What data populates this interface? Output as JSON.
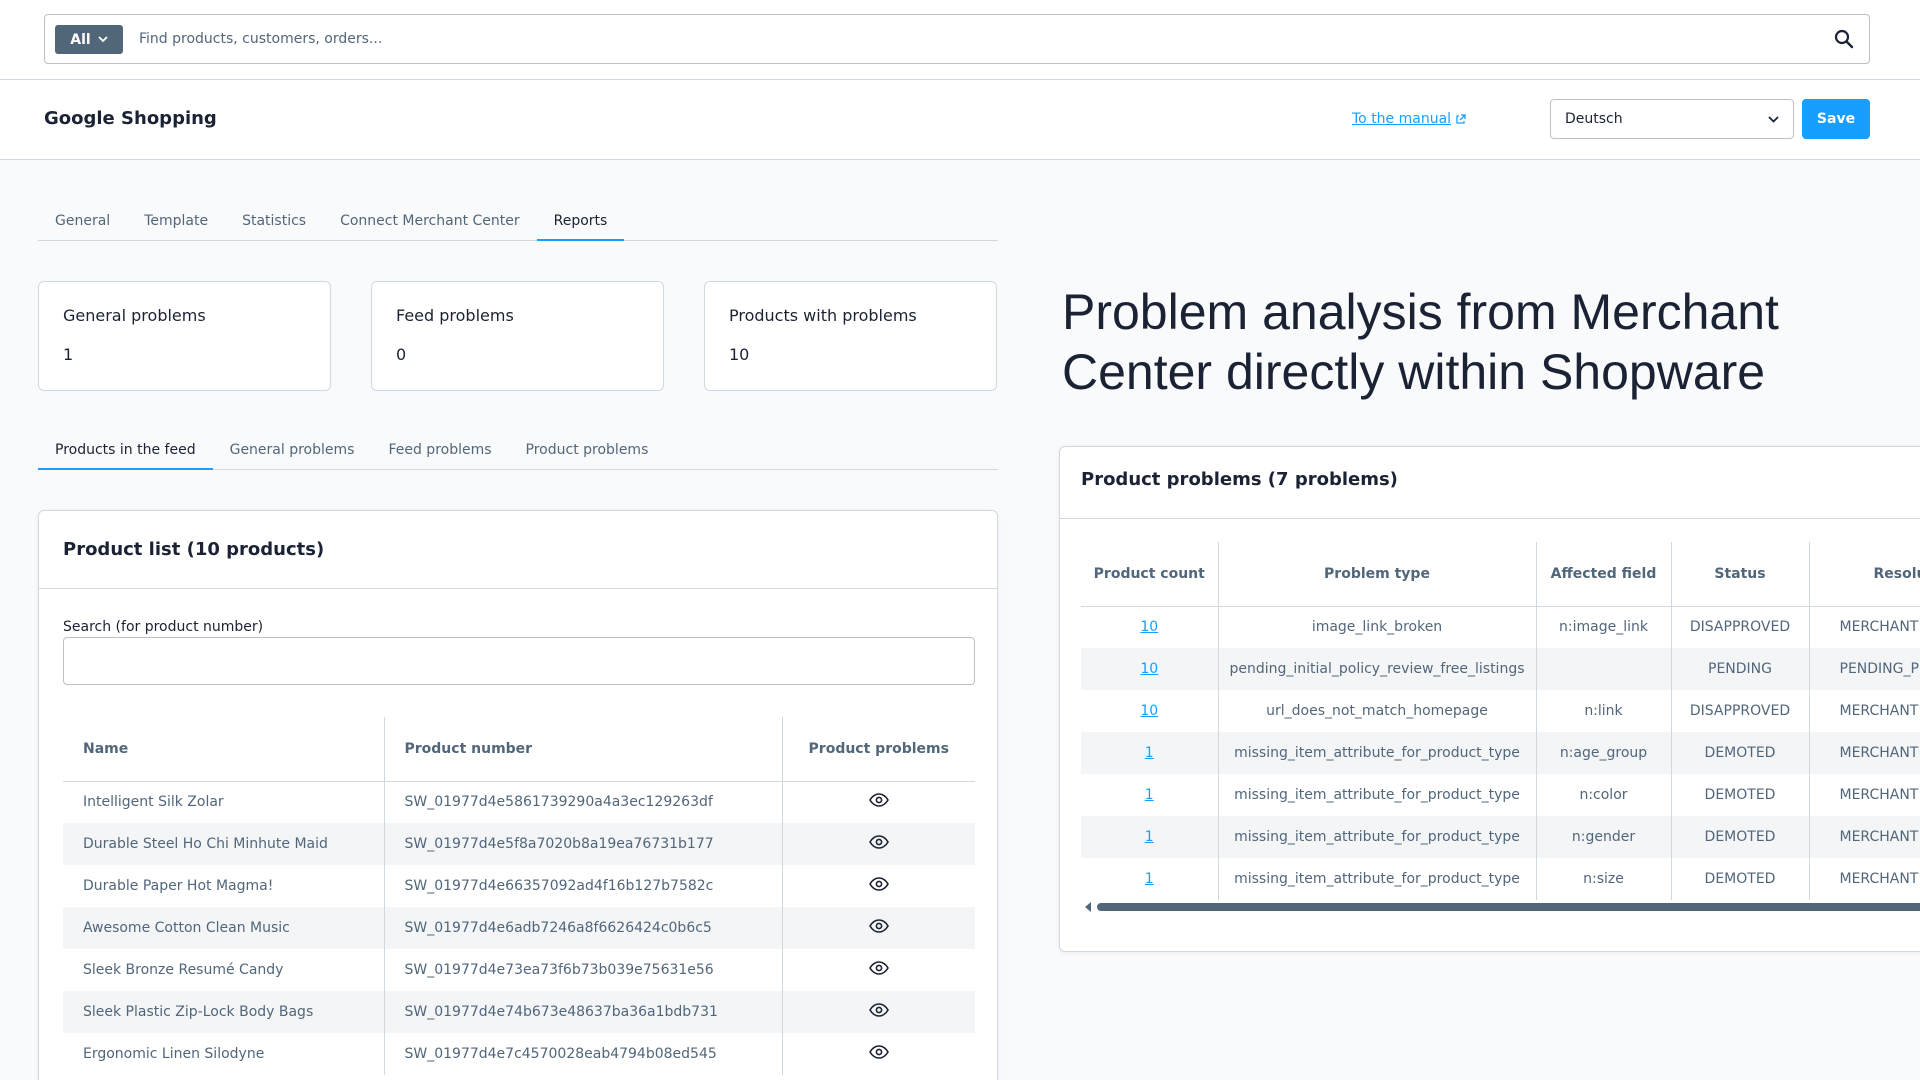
{
  "search": {
    "scope": "All",
    "placeholder": "Find products, customers, orders..."
  },
  "header": {
    "title": "Google Shopping",
    "manual_link": "To the manual",
    "language": "Deutsch",
    "save_label": "Save"
  },
  "main_tabs": [
    {
      "label": "General",
      "active": false
    },
    {
      "label": "Template",
      "active": false
    },
    {
      "label": "Statistics",
      "active": false
    },
    {
      "label": "Connect Merchant Center",
      "active": false
    },
    {
      "label": "Reports",
      "active": true
    }
  ],
  "stats": [
    {
      "label": "General problems",
      "value": "1"
    },
    {
      "label": "Feed problems",
      "value": "0"
    },
    {
      "label": "Products with problems",
      "value": "10"
    }
  ],
  "sub_tabs": [
    {
      "label": "Products in the feed",
      "active": true
    },
    {
      "label": "General problems",
      "active": false
    },
    {
      "label": "Feed problems",
      "active": false
    },
    {
      "label": "Product problems",
      "active": false
    }
  ],
  "product_list": {
    "title": "Product list (10 products)",
    "search_label": "Search (for product number)",
    "columns": [
      "Name",
      "Product number",
      "Product problems"
    ],
    "rows": [
      {
        "name": "Intelligent Silk Zolar",
        "number": "SW_01977d4e5861739290a4a3ec129263df"
      },
      {
        "name": "Durable Steel Ho Chi Minhute Maid",
        "number": "SW_01977d4e5f8a7020b8a19ea76731b177"
      },
      {
        "name": "Durable Paper Hot Magma!",
        "number": "SW_01977d4e66357092ad4f16b127b7582c"
      },
      {
        "name": "Awesome Cotton Clean Music",
        "number": "SW_01977d4e6adb7246a8f6626424c0b6c5"
      },
      {
        "name": "Sleek Bronze Resumé Candy",
        "number": "SW_01977d4e73ea73f6b73b039e75631e56"
      },
      {
        "name": "Sleek Plastic Zip-Lock Body Bags",
        "number": "SW_01977d4e74b673e48637ba36a1bdb731"
      },
      {
        "name": "Ergonomic Linen Silodyne",
        "number": "SW_01977d4e7c4570028eab4794b08ed545"
      }
    ]
  },
  "headline": "Problem analysis from Merchant Center directly within Shopware",
  "problems": {
    "title": "Product problems (7 problems)",
    "columns": [
      "Product count",
      "Problem type",
      "Affected field",
      "Status",
      "Resolu"
    ],
    "rows": [
      {
        "count": "10",
        "type": "image_link_broken",
        "field": "n:image_link",
        "status": "DISAPPROVED",
        "resolution": "MERCHANT"
      },
      {
        "count": "10",
        "type": "pending_initial_policy_review_free_listings",
        "field": "",
        "status": "PENDING",
        "resolution": "PENDING_PR"
      },
      {
        "count": "10",
        "type": "url_does_not_match_homepage",
        "field": "n:link",
        "status": "DISAPPROVED",
        "resolution": "MERCHANT"
      },
      {
        "count": "1",
        "type": "missing_item_attribute_for_product_type",
        "field": "n:age_group",
        "status": "DEMOTED",
        "resolution": "MERCHANT"
      },
      {
        "count": "1",
        "type": "missing_item_attribute_for_product_type",
        "field": "n:color",
        "status": "DEMOTED",
        "resolution": "MERCHANT"
      },
      {
        "count": "1",
        "type": "missing_item_attribute_for_product_type",
        "field": "n:gender",
        "status": "DEMOTED",
        "resolution": "MERCHANT"
      },
      {
        "count": "1",
        "type": "missing_item_attribute_for_product_type",
        "field": "n:size",
        "status": "DEMOTED",
        "resolution": "MERCHANT"
      }
    ]
  },
  "colors": {
    "accent": "#189eff",
    "text": "#1a2233",
    "muted": "#52667a",
    "border": "#d1d9e0"
  }
}
